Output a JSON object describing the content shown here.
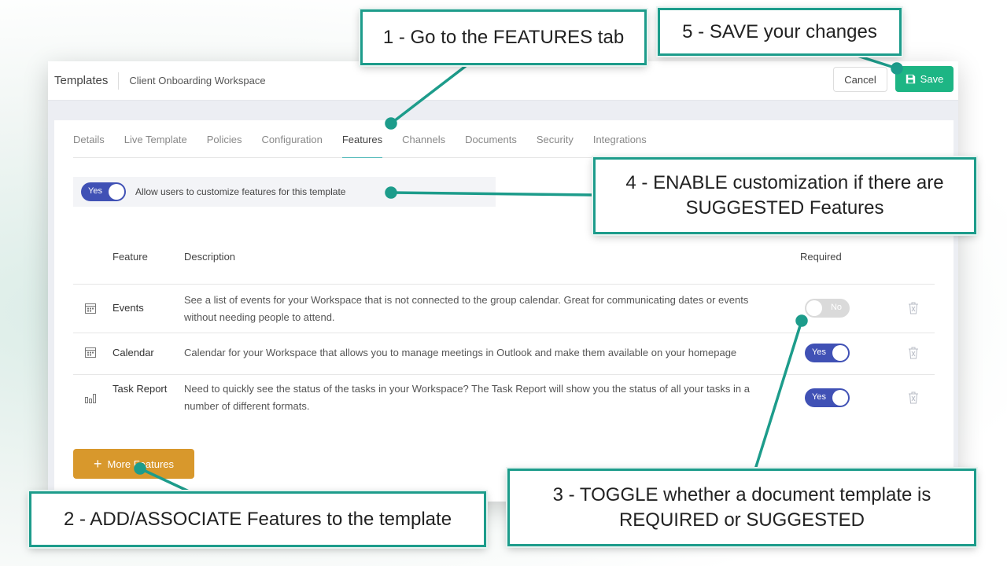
{
  "topbar": {
    "root": "Templates",
    "name": "Client Onboarding Workspace",
    "cancel": "Cancel",
    "save": "Save"
  },
  "tabs": [
    "Details",
    "Live Template",
    "Policies",
    "Configuration",
    "Features",
    "Channels",
    "Documents",
    "Security",
    "Integrations"
  ],
  "active_tab": "Features",
  "allow": {
    "toggle_label": "Yes",
    "text": "Allow users to customize features for this template"
  },
  "table": {
    "headers": {
      "feature": "Feature",
      "description": "Description",
      "required": "Required"
    },
    "rows": [
      {
        "name": "Events",
        "description": "See a list of events for your Workspace that is not connected to the group calendar. Great for communicating dates or events without needing people to attend.",
        "required": "No",
        "icon": "calendar-icon"
      },
      {
        "name": "Calendar",
        "description": "Calendar for your Workspace that allows you to manage meetings in Outlook and make them available on your homepage",
        "required": "Yes",
        "icon": "calendar-icon"
      },
      {
        "name": "Task Report",
        "description": "Need to quickly see the status of the tasks in your Workspace? The Task Report will show you the status of all your tasks in a number of different formats.",
        "required": "Yes",
        "icon": "bar-chart-icon"
      }
    ]
  },
  "more_features": "More Features",
  "callouts": {
    "c1": "1 - Go to the FEATURES tab",
    "c2": "2 - ADD/ASSOCIATE Features to the template",
    "c3": "3 - TOGGLE whether a document template is REQUIRED or SUGGESTED",
    "c4": "4 - ENABLE customization if there are SUGGESTED Features",
    "c5": "5 - SAVE your changes"
  },
  "colors": {
    "accent_teal": "#1d9c8b",
    "save_green": "#1db584",
    "toggle_blue": "#4051b5",
    "more_orange": "#d8982c"
  }
}
